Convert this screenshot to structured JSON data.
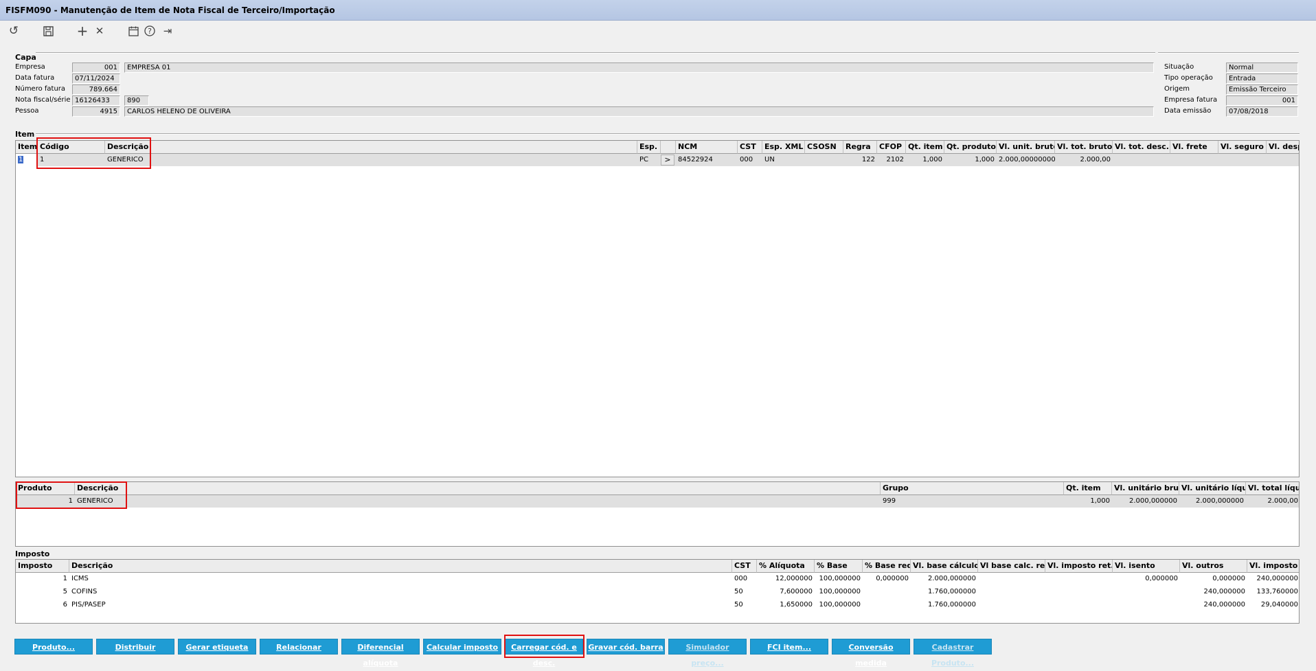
{
  "window": {
    "title": "FISFM090 - Manutenção de Item de Nota Fiscal de Terceiro/Importação"
  },
  "toolbar": {
    "icons": [
      "refresh-icon",
      "save-icon",
      "add-icon",
      "delete-icon",
      "calendar-icon",
      "help-icon",
      "exit-icon"
    ],
    "glyphs": {
      "refresh": "↺",
      "save": "💾",
      "add": "+",
      "delete": "✕",
      "calendar": "📅",
      "help": "?",
      "exit": "⇥"
    }
  },
  "capa": {
    "title": "Capa",
    "empresa_label": "Empresa",
    "empresa_code": "001",
    "empresa_name": "EMPRESA 01",
    "data_fatura_label": "Data fatura",
    "data_fatura": "07/11/2024",
    "numero_fatura_label": "Número fatura",
    "numero_fatura": "789.664",
    "nota_label": "Nota fiscal/série",
    "nota": "16126433",
    "serie": "890",
    "pessoa_label": "Pessoa",
    "pessoa_code": "4915",
    "pessoa_name": "CARLOS HELENO DE OLIVEIRA",
    "situacao_label": "Situação",
    "situacao": "Normal",
    "tipo_operacao_label": "Tipo operação",
    "tipo_operacao": "Entrada",
    "origem_label": "Origem",
    "origem": "Emissão Terceiro",
    "empresa_fatura_label": "Empresa fatura",
    "empresa_fatura": "001",
    "data_emissao_label": "Data emissão",
    "data_emissao": "07/08/2018"
  },
  "item_grid": {
    "title": "Item",
    "headers": [
      "Item",
      "Código",
      "Descrição",
      "Esp.",
      "",
      "NCM",
      "CST",
      "Esp. XML",
      "CSOSN",
      "Regra",
      "CFOP",
      "Qt. item",
      "Qt. produto",
      "Vl. unit. bruto",
      "Vl. tot. bruto",
      "Vl. tot. desc.",
      "Vl. frete",
      "Vl. seguro",
      "Vl. desp. ac."
    ],
    "row": {
      "item": "1",
      "codigo": "1",
      "descricao": "GENERICO",
      "esp": "PC",
      "expand": ">",
      "ncm": "84522924",
      "cst": "000",
      "esp_xml": "UN",
      "csosn": "",
      "regra": "122",
      "cfop": "2102",
      "qt_item": "1,000",
      "qt_produto": "1,000",
      "vl_unit_bruto": "2.000,0000000000",
      "vl_tot_bruto": "2.000,00",
      "vl_tot_desc": "",
      "vl_frete": "",
      "vl_seguro": "",
      "vl_desp_ac": ""
    }
  },
  "produto_grid": {
    "headers": [
      "Produto",
      "Descrição",
      "Grupo",
      "Qt. item",
      "Vl. unitário bruto",
      "Vl. unitário líquido",
      "Vl. total líquido"
    ],
    "row": {
      "produto": "1",
      "descricao": "GENERICO",
      "grupo": "999",
      "qt_item": "1,000",
      "vl_unit_bruto": "2.000,000000",
      "vl_unit_liquido": "2.000,000000",
      "vl_total_liquido": "2.000,00"
    }
  },
  "imposto_grid": {
    "title": "Imposto",
    "headers": [
      "Imposto",
      "Descrição",
      "CST",
      "% Alíquota",
      "% Base",
      "% Base red.",
      "Vl. base cálculo",
      "Vl base calc. ret.",
      "Vl. imposto ret.",
      "Vl. isento",
      "Vl. outros",
      "Vl. imposto"
    ],
    "rows": [
      {
        "imposto": "1",
        "descricao": "ICMS",
        "cst": "000",
        "aliquota": "12,000000",
        "base": "100,000000",
        "base_red": "0,000000",
        "vl_base": "2.000,000000",
        "vl_base_ret": "",
        "vl_imp_ret": "",
        "vl_isento": "0,000000",
        "vl_outros": "0,000000",
        "vl_imposto": "240,000000"
      },
      {
        "imposto": "5",
        "descricao": "COFINS",
        "cst": "50",
        "aliquota": "7,600000",
        "base": "100,000000",
        "base_red": "",
        "vl_base": "1.760,000000",
        "vl_base_ret": "",
        "vl_imp_ret": "",
        "vl_isento": "",
        "vl_outros": "240,000000",
        "vl_imposto": "133,760000"
      },
      {
        "imposto": "6",
        "descricao": "PIS/PASEP",
        "cst": "50",
        "aliquota": "1,650000",
        "base": "100,000000",
        "base_red": "",
        "vl_base": "1.760,000000",
        "vl_base_ret": "",
        "vl_imp_ret": "",
        "vl_isento": "",
        "vl_outros": "240,000000",
        "vl_imposto": "29,040000"
      }
    ]
  },
  "buttons": {
    "produto": "Produto...",
    "distribuir": "Distribuir",
    "gerar_etiqueta": "Gerar etiqueta",
    "relacionar": "Relacionar",
    "diferencial": "Diferencial alíquota",
    "calcular": "Calcular imposto",
    "carregar": "Carregar cód. e desc.",
    "gravar": "Gravar cód. barra",
    "simulador": "Simulador preço...",
    "fci": "FCI item...",
    "conversao": "Conversão medida",
    "cadastrar": "Cadastrar Produto..."
  },
  "colors": {
    "button": "#1f9cd4",
    "titlebar": "#b5c6e3",
    "highlight": "#e01010"
  }
}
